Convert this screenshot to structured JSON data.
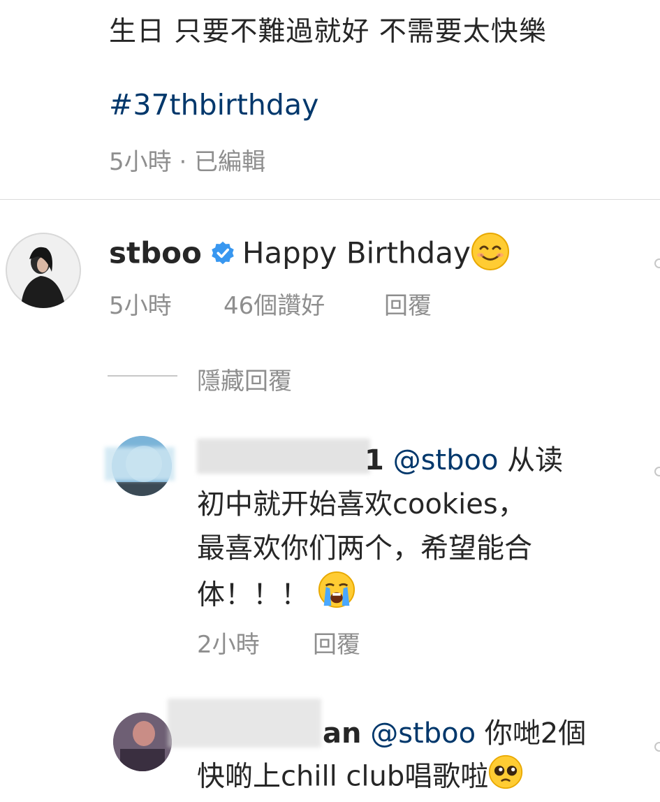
{
  "post": {
    "caption": "生日 只要不難過就好 不需要太快樂",
    "hashtag": "#37thbirthday",
    "meta": "5小時 · 已編輯"
  },
  "comments": [
    {
      "username": "stboo",
      "verified": true,
      "text": "Happy Birthday",
      "emoji": "smiling-face-icon",
      "time": "5小時",
      "likes": "46個讚好",
      "reply": "回覆",
      "hide_replies": "隱藏回覆"
    },
    {
      "username": "1",
      "mention": "@stboo",
      "lines": [
        "从读",
        "初中就开始喜欢cookies，",
        "最喜欢你们两个，希望能合",
        "体！！！"
      ],
      "emoji": "loudly-crying-face-icon",
      "time": "2小時",
      "reply": "回覆"
    },
    {
      "username": "an",
      "mention": "@stboo",
      "lines": [
        "你哋2個",
        "快啲上chill club唱歌啦"
      ],
      "emoji": "pleading-face-icon"
    }
  ]
}
